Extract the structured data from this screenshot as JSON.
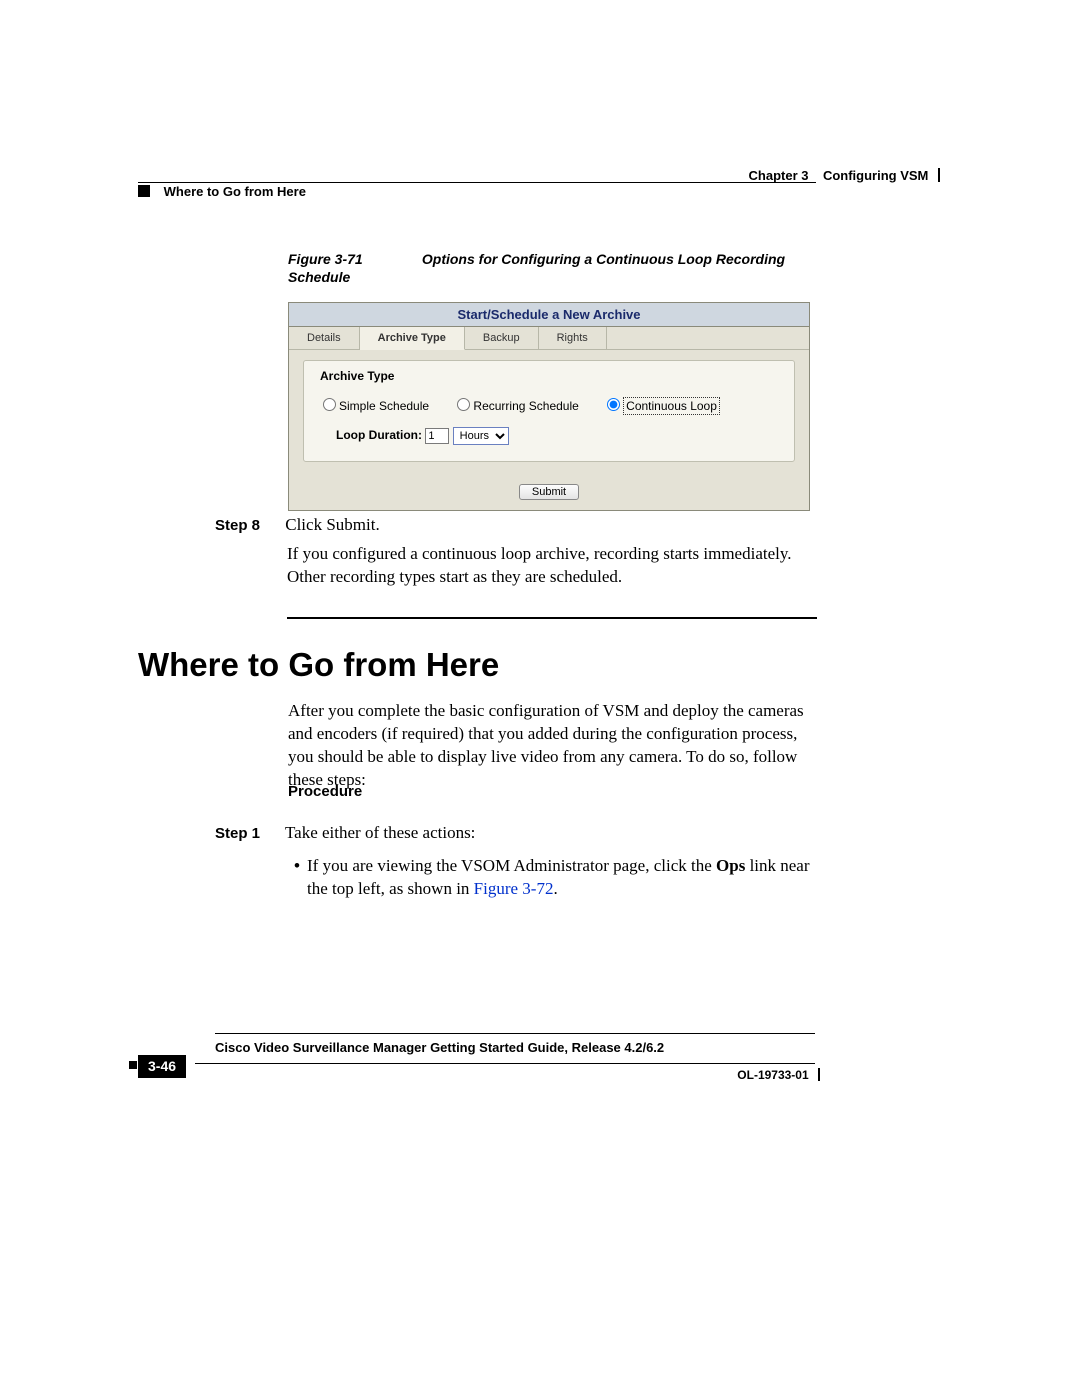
{
  "running_header": {
    "chapter": "Chapter 3",
    "title": "Configuring VSM",
    "section": "Where to Go from Here"
  },
  "figure": {
    "number": "Figure 3-71",
    "caption": "Options for Configuring a Continuous Loop Recording Schedule"
  },
  "panel": {
    "title": "Start/Schedule a New Archive",
    "tabs": [
      "Details",
      "Archive Type",
      "Backup",
      "Rights"
    ],
    "active_tab": "Archive Type",
    "fieldset_legend": "Archive Type",
    "radios": {
      "simple": "Simple Schedule",
      "recurring": "Recurring Schedule",
      "continuous": "Continuous Loop"
    },
    "loop_label": "Loop Duration:",
    "loop_value": "1",
    "loop_unit": "Hours",
    "submit": "Submit"
  },
  "step8": {
    "label": "Step 8",
    "line1": "Click Submit.",
    "line2": "If you configured a continuous loop archive, recording starts immediately. Other recording types start as they are scheduled."
  },
  "heading": "Where to Go from Here",
  "intro": "After you complete the basic configuration of VSM and deploy the cameras and encoders (if required) that you added during the configuration process, you should be able to display live video from any camera. To do so, follow these steps:",
  "procedure_label": "Procedure",
  "step1": {
    "label": "Step 1",
    "text": "Take either of these actions:",
    "bullet_pre": "If you are viewing the VSOM Administrator page, click the ",
    "bullet_bold": "Ops",
    "bullet_mid": " link near the top left, as shown in ",
    "bullet_link": "Figure 3-72",
    "bullet_post": "."
  },
  "footer": {
    "guide": "Cisco Video Surveillance Manager Getting Started Guide, Release 4.2/6.2",
    "page": "3-46",
    "docid": "OL-19733-01"
  }
}
